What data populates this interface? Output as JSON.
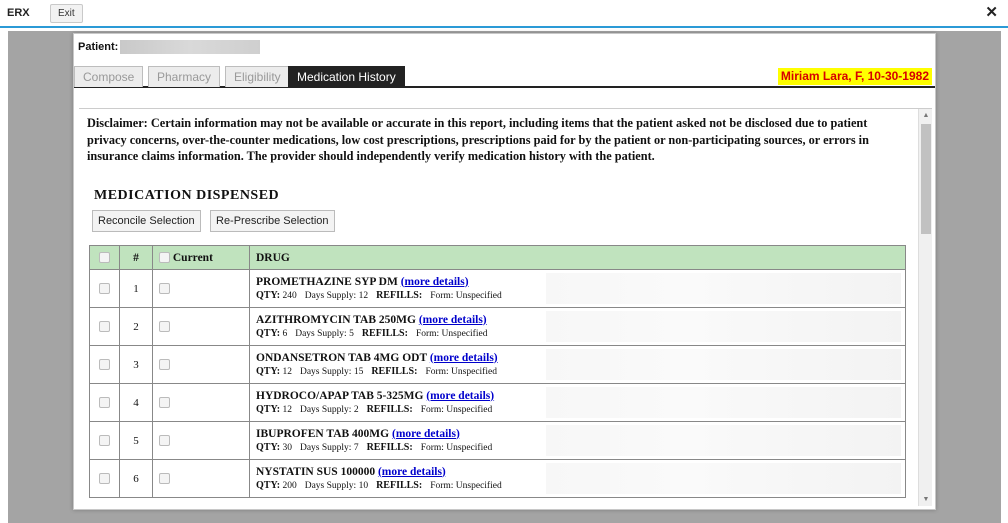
{
  "app": {
    "title": "ERX",
    "exit_label": "Exit",
    "close_glyph": "✕"
  },
  "patient": {
    "label": "Patient:"
  },
  "tabs": [
    {
      "label": "Compose",
      "active": false
    },
    {
      "label": "Pharmacy",
      "active": false
    },
    {
      "label": "Eligibility",
      "active": false
    },
    {
      "label": "Medication History",
      "active": true
    }
  ],
  "patient_banner": "Miriam Lara, F, 10-30-1982",
  "disclaimer": "Disclaimer: Certain information may not be available or accurate in this report, including items that the patient asked not be disclosed due to patient privacy concerns, over-the-counter medications, low cost prescriptions, prescriptions paid for by the patient or non-participating sources, or errors in insurance claims information. The provider should independently verify medication history with the patient.",
  "section_title": "MEDICATION DISPENSED",
  "buttons": {
    "reconcile": "Reconcile Selection",
    "represcribe": "Re-Prescribe Selection"
  },
  "table": {
    "headers": {
      "num": "#",
      "current": "Current",
      "drug": "DRUG"
    },
    "more_link": "(more details)",
    "labels": {
      "qty": "QTY:",
      "days": "Days Supply:",
      "refills": "REFILLS:",
      "form": "Form:"
    },
    "rows": [
      {
        "num": "1",
        "name": "PROMETHAZINE SYP DM",
        "qty": "240",
        "days": "12",
        "form": "Unspecified"
      },
      {
        "num": "2",
        "name": "AZITHROMYCIN TAB 250MG",
        "qty": "6",
        "days": "5",
        "form": "Unspecified"
      },
      {
        "num": "3",
        "name": "ONDANSETRON TAB 4MG ODT",
        "qty": "12",
        "days": "15",
        "form": "Unspecified"
      },
      {
        "num": "4",
        "name": "HYDROCO/APAP TAB 5-325MG",
        "qty": "12",
        "days": "2",
        "form": "Unspecified"
      },
      {
        "num": "5",
        "name": "IBUPROFEN TAB 400MG",
        "qty": "30",
        "days": "7",
        "form": "Unspecified"
      },
      {
        "num": "6",
        "name": "NYSTATIN SUS 100000",
        "qty": "200",
        "days": "10",
        "form": "Unspecified"
      }
    ]
  },
  "colors": {
    "accent": "#2b9ad6",
    "table_header": "#c0e3be",
    "banner_bg": "#ffff00",
    "banner_text": "#d60000",
    "link": "#0000cc"
  },
  "icons": {
    "close": "close-icon",
    "scroll_up": "scroll-up-icon",
    "scroll_down": "scroll-down-icon"
  }
}
